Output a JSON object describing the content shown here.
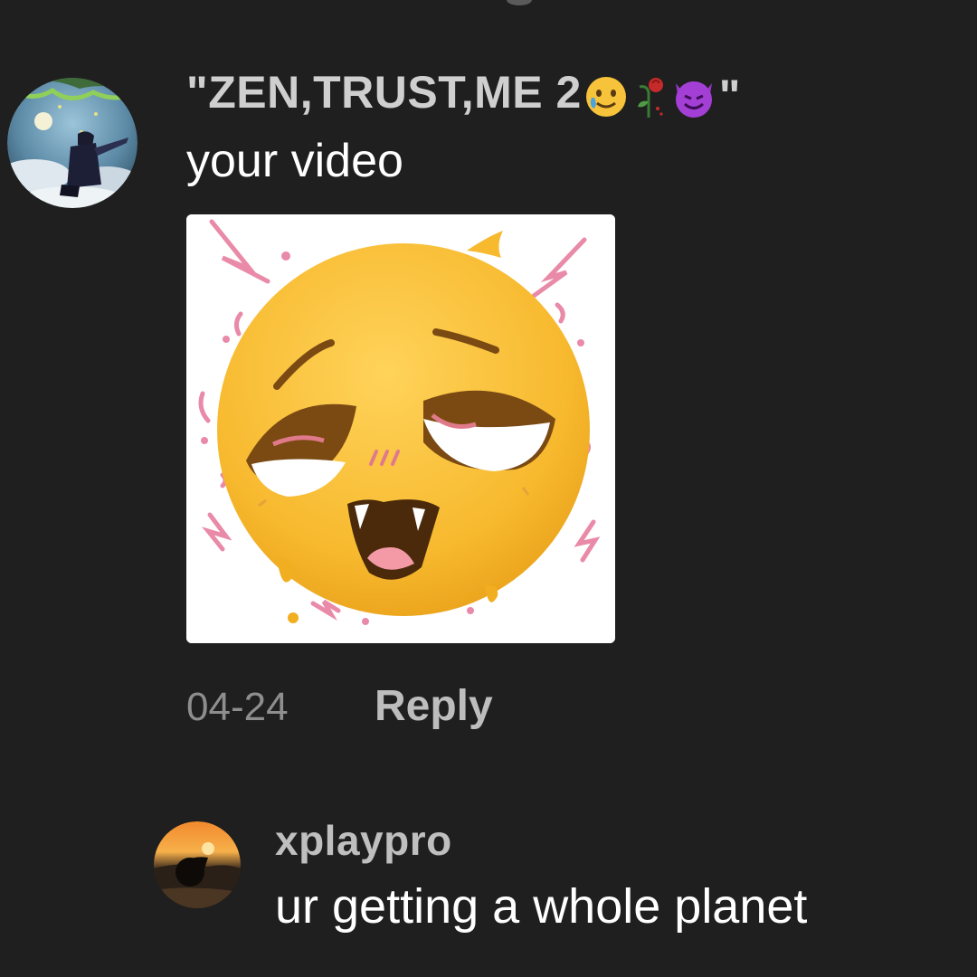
{
  "comments": [
    {
      "username": "\"ZEN,TRUST,ME 2",
      "username_emojis": [
        "smiling-face-with-tear",
        "wilted-rose",
        "smiling-face-with-horns"
      ],
      "username_suffix": "\"",
      "text": "your video",
      "attachment": "sticker",
      "date": "04-24",
      "reply_label": "Reply",
      "avatar": "anime-character-avatar"
    },
    {
      "username": "xplaypro",
      "text": "ur getting a whole planet",
      "avatar": "sunset-avatar"
    }
  ],
  "colors": {
    "background": "#1f1f1f",
    "username_text": "#cfcfcf",
    "comment_text": "#ffffff",
    "meta_text": "#8e8e8e",
    "reply_text": "#bdbdbd"
  }
}
